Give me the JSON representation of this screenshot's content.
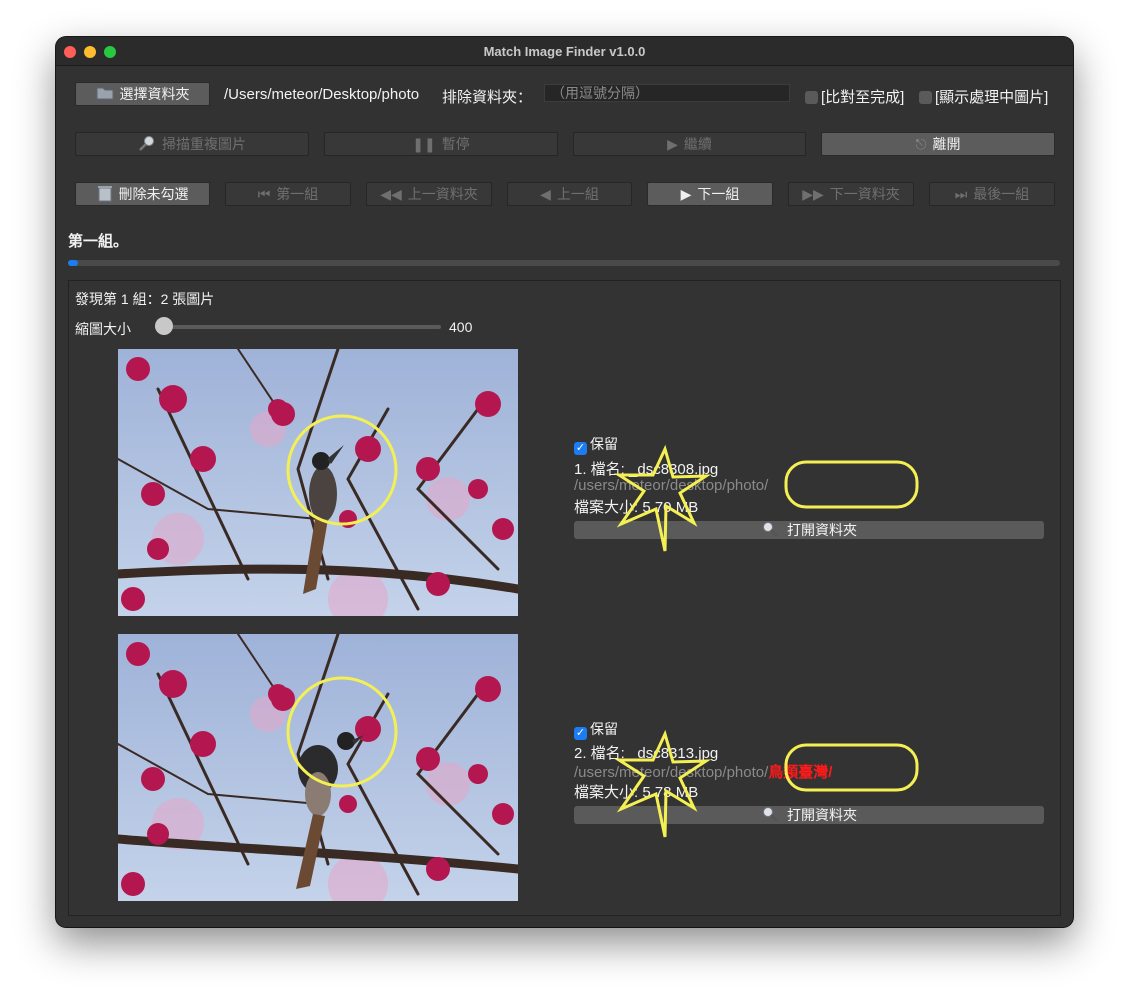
{
  "window": {
    "title": "Match Image Finder v1.0.0"
  },
  "toolbar": {
    "choose_folder": "選擇資料夾",
    "folder_path": "/Users/meteor/Desktop/photo",
    "exclude_label": "排除資料夾：",
    "exclude_placeholder": "（用逗號分隔）",
    "compare_to_end": "[比對至完成]",
    "show_processing": "[顯示處理中圖片]",
    "scan": "掃描重複圖片",
    "pause": "暫停",
    "resume": "繼續",
    "quit": "離開",
    "delete_unchecked": "刪除未勾選",
    "first_group": "第一組",
    "prev_folder": "上一資料夾",
    "prev_group": "上一組",
    "next_group": "下一組",
    "next_folder": "下一資料夾",
    "last_group": "最後一組"
  },
  "status": {
    "text": "第一組。",
    "progress": 0.01
  },
  "results": {
    "found_text": "發現第 1 組：2 張圖片",
    "thumb_label": "縮圖大小",
    "thumb_size": "400",
    "thumb_fraction": 0.0,
    "items": [
      {
        "keep_label": "保留",
        "kept": true,
        "name": "1. 檔名: _dsc8308.jpg",
        "path": "/users/meteor/desktop/photo/",
        "path_extra": "",
        "size": "檔案大小: 5.70 MB",
        "open_label": "打開資料夾"
      },
      {
        "keep_label": "保留",
        "kept": true,
        "name": "2. 檔名: _dsc8313.jpg",
        "path": "/users/meteor/desktop/photo/",
        "path_extra": "鳥類臺灣/",
        "size": "檔案大小: 5.78 MB",
        "open_label": "打開資料夾"
      }
    ]
  },
  "colors": {
    "accent": "#1c7cf4",
    "annotation": "#f4f054",
    "warning_text": "#ff1a1a"
  }
}
